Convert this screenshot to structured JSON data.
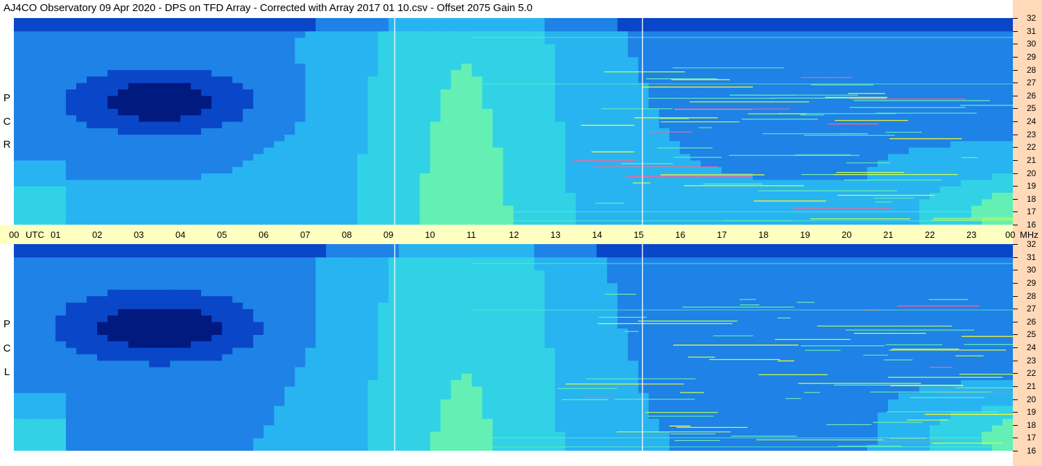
{
  "header": {
    "title": "AJ4CO Observatory  09 Apr 2020  -  DPS on TFD Array  -  Corrected with Array 2017 01 10.csv  -  Offset 2075  Gain 5.0"
  },
  "colors": {
    "background": "#ffffff",
    "time_bar": "#ffffc2",
    "freq_panel": "#ffd9b8",
    "colormap": [
      "#000010",
      "#001a80",
      "#0a46c8",
      "#1e82e6",
      "#28b4f0",
      "#32d2e6",
      "#64f0b4",
      "#c8ff50",
      "#ffff28",
      "#ff6496"
    ]
  },
  "chart_data": {
    "type": "heatmap",
    "title": "AJ4CO Observatory  09 Apr 2020  -  DPS on TFD Array  -  Corrected with Array 2017 01 10.csv  -  Offset 2075  Gain 5.0",
    "time_axis": {
      "tick_labels": [
        "00",
        "01",
        "02",
        "03",
        "04",
        "05",
        "06",
        "07",
        "08",
        "09",
        "10",
        "11",
        "12",
        "13",
        "14",
        "15",
        "16",
        "17",
        "18",
        "19",
        "20",
        "21",
        "22",
        "23",
        "00"
      ],
      "unit_label": "UTC",
      "range_hours": [
        0,
        24
      ]
    },
    "freq_axis": {
      "tick_labels": [
        "16",
        "17",
        "18",
        "19",
        "20",
        "21",
        "22",
        "23",
        "24",
        "25",
        "26",
        "27",
        "28",
        "29",
        "30",
        "31",
        "32"
      ],
      "unit_label": "MHz",
      "range_mhz": [
        16,
        32
      ]
    },
    "panels": [
      {
        "label": [
          "R",
          "C",
          "P"
        ]
      },
      {
        "label": [
          "L",
          "C",
          "P"
        ]
      }
    ],
    "markers_utc_hours": [
      9.15,
      15.1
    ]
  }
}
